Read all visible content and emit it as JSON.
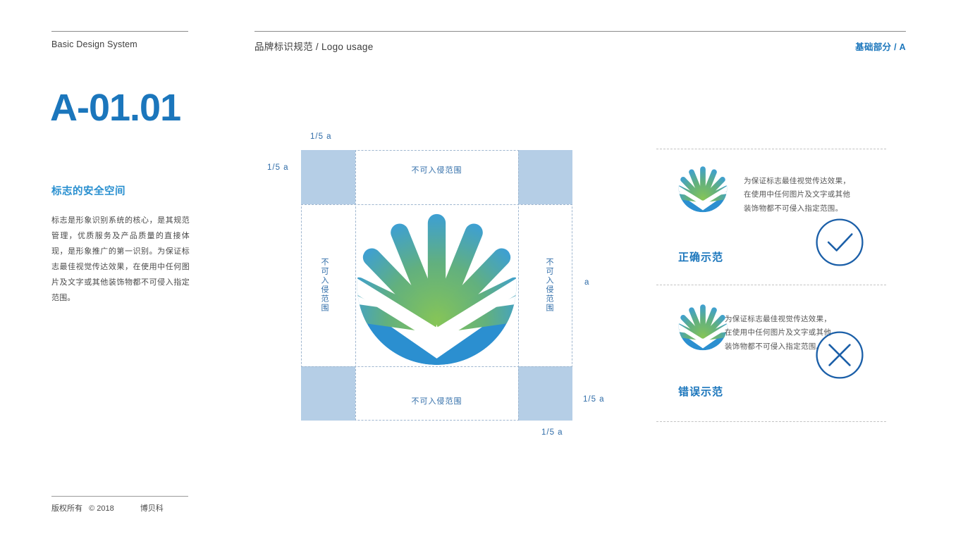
{
  "header": {
    "brand_label": "Basic Design System",
    "title": "品牌标识规范 / Logo usage",
    "section_ref": "基础部分 / A"
  },
  "sidebar": {
    "page_code": "A-01.01",
    "section_title": "标志的安全空间",
    "section_body": "标志是形象识别系统的核心，是其规范管理，优质服务及产品质量的直接体现，是形象推广的第一识别。为保证标志最佳视觉传达效果，在使用中任何图片及文字或其他装饰物都不可侵入指定范围。"
  },
  "footer": {
    "copyright_label": "版权所有",
    "year": "© 2018",
    "company": "博贝科"
  },
  "diagram": {
    "zone_label_top": "不可入侵范围",
    "zone_label_bottom": "不可入侵范围",
    "zone_label_left": "不可入侵范围",
    "zone_label_right": "不可入侵范围",
    "dim_top_left": "1/5 a",
    "dim_left": "1/5 a",
    "dim_bottom_right_1": "1/5 a",
    "dim_bottom_right_2": "1/5 a",
    "dim_a": "a"
  },
  "examples": {
    "correct": {
      "description": "为保证标志最佳视觉传达效果，\n在使用中任何图片及文字或其他\n装饰物都不可侵入指定范围。",
      "caption": "正确示范",
      "mark": "check-icon"
    },
    "wrong": {
      "description": "为保证标志最佳视觉传达效果，\n在使用中任何图片及文字或其他\n装饰物都不可侵入指定范围。",
      "caption": "错误示范",
      "mark": "cross-icon"
    }
  },
  "colors": {
    "accent_blue": "#1b76bc",
    "title_blue": "#2a90d0",
    "logo_petal_top": "#3d9fd4",
    "logo_petal_bottom": "#7dc24b",
    "logo_bowl": "#2b8fd0",
    "safe_zone_fill": "#b5cee6",
    "guide_line": "#9fb6cf"
  }
}
